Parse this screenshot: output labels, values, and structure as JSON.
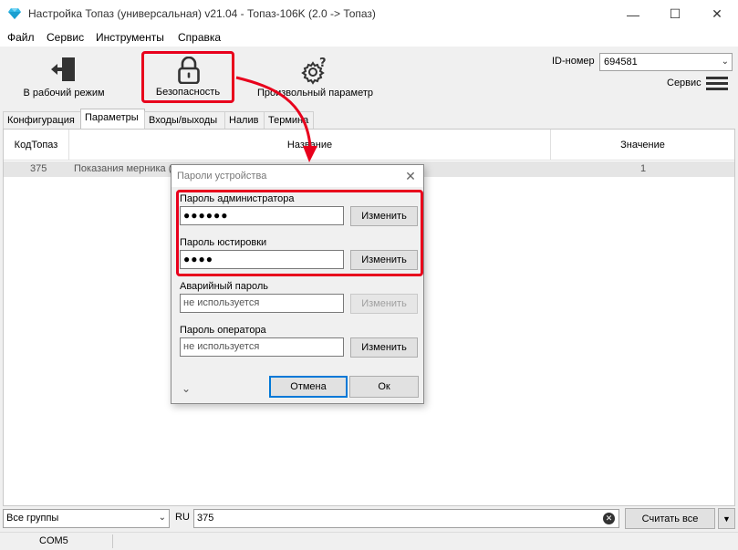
{
  "window": {
    "title": "Настройка Топаз (универсальная) v21.04 - Топаз-106K (2.0 -> Топаз)",
    "controls": {
      "minimize": "—",
      "maximize": "☐",
      "close": "✕"
    }
  },
  "menu": {
    "items": [
      "Файл",
      "Сервис",
      "Инструменты",
      "Справка"
    ]
  },
  "toolbar": {
    "work_mode_label": "В рабочий режим",
    "security_label": "Безопасность",
    "custom_param_label": "Произвольный параметр",
    "id_label": "ID-номер",
    "id_value": "694581",
    "service_label": "Сервис"
  },
  "tabs": {
    "items": [
      "Конфигурация",
      "Параметры",
      "Входы/выходы",
      "Налив",
      "Термина"
    ],
    "active": "Параметры"
  },
  "grid": {
    "columns": [
      "КодТопаз",
      "Название",
      "Значение"
    ],
    "rows": [
      {
        "code": "375",
        "name": "Показания мерника (л",
        "value": "1"
      }
    ]
  },
  "dialog": {
    "title": "Пароли устройства",
    "close": "✕",
    "admin_label": "Пароль администратора",
    "admin_value": "●●●●●●",
    "admin_button": "Изменить",
    "adjust_label": "Пароль юстировки",
    "adjust_value": "●●●●",
    "adjust_button": "Изменить",
    "emergency_label": "Аварийный пароль",
    "emergency_value": "не используется",
    "emergency_button": "Изменить",
    "operator_label": "Пароль оператора",
    "operator_value": "не используется",
    "operator_button": "Изменить",
    "expand_glyph": "⌄",
    "cancel_button": "Отмена",
    "ok_button": "Ок"
  },
  "bottom": {
    "group_value": "Все группы",
    "lang": "RU",
    "search_value": "375",
    "read_all_button": "Считать все",
    "read_more_glyph": "▼"
  },
  "status": {
    "port": "COM5"
  },
  "colors": {
    "highlight": "#e8001c",
    "accent": "#0078d7"
  }
}
